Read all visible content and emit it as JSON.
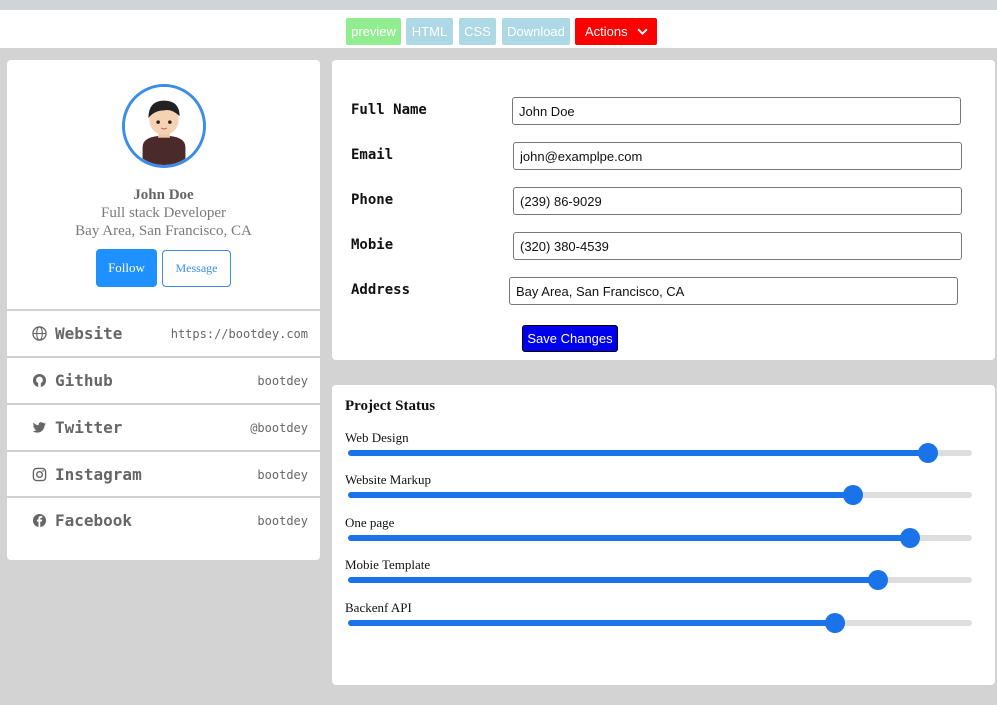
{
  "toolbar": {
    "preview": "preview",
    "html": "HTML",
    "css": "CSS",
    "download": "Download",
    "actions": "Actions"
  },
  "profile": {
    "name": "John Doe",
    "role": "Full stack Developer",
    "location": "Bay Area, San Francisco, CA",
    "follow_label": "Follow",
    "message_label": "Message"
  },
  "social": [
    {
      "label": "Website",
      "value": "https://bootdey.com",
      "icon": "globe-icon"
    },
    {
      "label": "Github",
      "value": "bootdey",
      "icon": "github-icon"
    },
    {
      "label": "Twitter",
      "value": "@bootdey",
      "icon": "twitter-icon"
    },
    {
      "label": "Instagram",
      "value": "bootdey",
      "icon": "instagram-icon"
    },
    {
      "label": "Facebook",
      "value": "bootdey",
      "icon": "facebook-icon"
    }
  ],
  "form": {
    "fields": [
      {
        "label": "Full Name",
        "value": "John Doe"
      },
      {
        "label": "Email",
        "value": "john@examplpe.com"
      },
      {
        "label": "Phone",
        "value": "(239) 86-9029"
      },
      {
        "label": "Mobie",
        "value": "(320) 380-4539"
      },
      {
        "label": "Address",
        "value": "Bay Area, San Francisco, CA"
      }
    ],
    "save_label": "Save Changes"
  },
  "status": {
    "title": "Project Status",
    "items": [
      {
        "label": "Web Design",
        "value": 93
      },
      {
        "label": "Website Markup",
        "value": 81
      },
      {
        "label": "One page",
        "value": 90
      },
      {
        "label": "Mobie Template",
        "value": 85
      },
      {
        "label": "Backenf API",
        "value": 78
      }
    ]
  },
  "colors": {
    "accent": "#1a73e8",
    "follow": "#1e90ff",
    "save": "#0000ee",
    "actions": "#ff0000",
    "preview": "#90ee90",
    "tab": "#add8e6"
  }
}
